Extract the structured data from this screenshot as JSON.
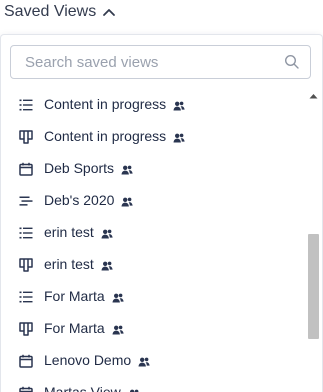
{
  "trigger": {
    "label": "Saved Views",
    "icon": "chevron-up-icon"
  },
  "search": {
    "placeholder": "Search saved views",
    "value": ""
  },
  "views": [
    {
      "label": "Content in progress",
      "type_icon": "list-icon",
      "shared_icon": "shared-users-icon"
    },
    {
      "label": "Content in progress",
      "type_icon": "board-icon",
      "shared_icon": "shared-users-icon"
    },
    {
      "label": "Deb Sports",
      "type_icon": "calendar-icon",
      "shared_icon": "shared-users-icon"
    },
    {
      "label": "Deb's 2020",
      "type_icon": "timeline-icon",
      "shared_icon": "shared-users-icon"
    },
    {
      "label": "erin test",
      "type_icon": "list-icon",
      "shared_icon": "shared-users-icon"
    },
    {
      "label": "erin test",
      "type_icon": "board-icon",
      "shared_icon": "shared-users-icon"
    },
    {
      "label": "For Marta",
      "type_icon": "list-icon",
      "shared_icon": "shared-users-icon"
    },
    {
      "label": "For Marta",
      "type_icon": "board-icon",
      "shared_icon": "shared-users-icon"
    },
    {
      "label": "Lenovo Demo",
      "type_icon": "calendar-icon",
      "shared_icon": "shared-users-icon"
    },
    {
      "label": "Martas View",
      "type_icon": "calendar-icon",
      "shared_icon": "shared-users-icon"
    }
  ],
  "colors": {
    "text": "#1f2a44",
    "icon": "#2a3550",
    "placeholder": "#9aa1ae",
    "scroll_thumb": "#c1c1c1"
  }
}
